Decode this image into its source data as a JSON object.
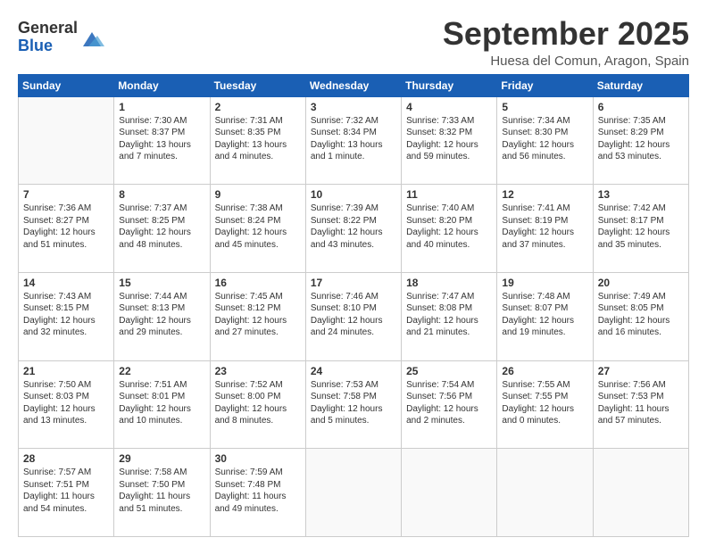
{
  "header": {
    "logo_general": "General",
    "logo_blue": "Blue",
    "month_title": "September 2025",
    "location": "Huesa del Comun, Aragon, Spain"
  },
  "days_of_week": [
    "Sunday",
    "Monday",
    "Tuesday",
    "Wednesday",
    "Thursday",
    "Friday",
    "Saturday"
  ],
  "weeks": [
    [
      {
        "day": "",
        "sunrise": "",
        "sunset": "",
        "daylight": ""
      },
      {
        "day": "1",
        "sunrise": "Sunrise: 7:30 AM",
        "sunset": "Sunset: 8:37 PM",
        "daylight": "Daylight: 13 hours and 7 minutes."
      },
      {
        "day": "2",
        "sunrise": "Sunrise: 7:31 AM",
        "sunset": "Sunset: 8:35 PM",
        "daylight": "Daylight: 13 hours and 4 minutes."
      },
      {
        "day": "3",
        "sunrise": "Sunrise: 7:32 AM",
        "sunset": "Sunset: 8:34 PM",
        "daylight": "Daylight: 13 hours and 1 minute."
      },
      {
        "day": "4",
        "sunrise": "Sunrise: 7:33 AM",
        "sunset": "Sunset: 8:32 PM",
        "daylight": "Daylight: 12 hours and 59 minutes."
      },
      {
        "day": "5",
        "sunrise": "Sunrise: 7:34 AM",
        "sunset": "Sunset: 8:30 PM",
        "daylight": "Daylight: 12 hours and 56 minutes."
      },
      {
        "day": "6",
        "sunrise": "Sunrise: 7:35 AM",
        "sunset": "Sunset: 8:29 PM",
        "daylight": "Daylight: 12 hours and 53 minutes."
      }
    ],
    [
      {
        "day": "7",
        "sunrise": "Sunrise: 7:36 AM",
        "sunset": "Sunset: 8:27 PM",
        "daylight": "Daylight: 12 hours and 51 minutes."
      },
      {
        "day": "8",
        "sunrise": "Sunrise: 7:37 AM",
        "sunset": "Sunset: 8:25 PM",
        "daylight": "Daylight: 12 hours and 48 minutes."
      },
      {
        "day": "9",
        "sunrise": "Sunrise: 7:38 AM",
        "sunset": "Sunset: 8:24 PM",
        "daylight": "Daylight: 12 hours and 45 minutes."
      },
      {
        "day": "10",
        "sunrise": "Sunrise: 7:39 AM",
        "sunset": "Sunset: 8:22 PM",
        "daylight": "Daylight: 12 hours and 43 minutes."
      },
      {
        "day": "11",
        "sunrise": "Sunrise: 7:40 AM",
        "sunset": "Sunset: 8:20 PM",
        "daylight": "Daylight: 12 hours and 40 minutes."
      },
      {
        "day": "12",
        "sunrise": "Sunrise: 7:41 AM",
        "sunset": "Sunset: 8:19 PM",
        "daylight": "Daylight: 12 hours and 37 minutes."
      },
      {
        "day": "13",
        "sunrise": "Sunrise: 7:42 AM",
        "sunset": "Sunset: 8:17 PM",
        "daylight": "Daylight: 12 hours and 35 minutes."
      }
    ],
    [
      {
        "day": "14",
        "sunrise": "Sunrise: 7:43 AM",
        "sunset": "Sunset: 8:15 PM",
        "daylight": "Daylight: 12 hours and 32 minutes."
      },
      {
        "day": "15",
        "sunrise": "Sunrise: 7:44 AM",
        "sunset": "Sunset: 8:13 PM",
        "daylight": "Daylight: 12 hours and 29 minutes."
      },
      {
        "day": "16",
        "sunrise": "Sunrise: 7:45 AM",
        "sunset": "Sunset: 8:12 PM",
        "daylight": "Daylight: 12 hours and 27 minutes."
      },
      {
        "day": "17",
        "sunrise": "Sunrise: 7:46 AM",
        "sunset": "Sunset: 8:10 PM",
        "daylight": "Daylight: 12 hours and 24 minutes."
      },
      {
        "day": "18",
        "sunrise": "Sunrise: 7:47 AM",
        "sunset": "Sunset: 8:08 PM",
        "daylight": "Daylight: 12 hours and 21 minutes."
      },
      {
        "day": "19",
        "sunrise": "Sunrise: 7:48 AM",
        "sunset": "Sunset: 8:07 PM",
        "daylight": "Daylight: 12 hours and 19 minutes."
      },
      {
        "day": "20",
        "sunrise": "Sunrise: 7:49 AM",
        "sunset": "Sunset: 8:05 PM",
        "daylight": "Daylight: 12 hours and 16 minutes."
      }
    ],
    [
      {
        "day": "21",
        "sunrise": "Sunrise: 7:50 AM",
        "sunset": "Sunset: 8:03 PM",
        "daylight": "Daylight: 12 hours and 13 minutes."
      },
      {
        "day": "22",
        "sunrise": "Sunrise: 7:51 AM",
        "sunset": "Sunset: 8:01 PM",
        "daylight": "Daylight: 12 hours and 10 minutes."
      },
      {
        "day": "23",
        "sunrise": "Sunrise: 7:52 AM",
        "sunset": "Sunset: 8:00 PM",
        "daylight": "Daylight: 12 hours and 8 minutes."
      },
      {
        "day": "24",
        "sunrise": "Sunrise: 7:53 AM",
        "sunset": "Sunset: 7:58 PM",
        "daylight": "Daylight: 12 hours and 5 minutes."
      },
      {
        "day": "25",
        "sunrise": "Sunrise: 7:54 AM",
        "sunset": "Sunset: 7:56 PM",
        "daylight": "Daylight: 12 hours and 2 minutes."
      },
      {
        "day": "26",
        "sunrise": "Sunrise: 7:55 AM",
        "sunset": "Sunset: 7:55 PM",
        "daylight": "Daylight: 12 hours and 0 minutes."
      },
      {
        "day": "27",
        "sunrise": "Sunrise: 7:56 AM",
        "sunset": "Sunset: 7:53 PM",
        "daylight": "Daylight: 11 hours and 57 minutes."
      }
    ],
    [
      {
        "day": "28",
        "sunrise": "Sunrise: 7:57 AM",
        "sunset": "Sunset: 7:51 PM",
        "daylight": "Daylight: 11 hours and 54 minutes."
      },
      {
        "day": "29",
        "sunrise": "Sunrise: 7:58 AM",
        "sunset": "Sunset: 7:50 PM",
        "daylight": "Daylight: 11 hours and 51 minutes."
      },
      {
        "day": "30",
        "sunrise": "Sunrise: 7:59 AM",
        "sunset": "Sunset: 7:48 PM",
        "daylight": "Daylight: 11 hours and 49 minutes."
      },
      {
        "day": "",
        "sunrise": "",
        "sunset": "",
        "daylight": ""
      },
      {
        "day": "",
        "sunrise": "",
        "sunset": "",
        "daylight": ""
      },
      {
        "day": "",
        "sunrise": "",
        "sunset": "",
        "daylight": ""
      },
      {
        "day": "",
        "sunrise": "",
        "sunset": "",
        "daylight": ""
      }
    ]
  ]
}
